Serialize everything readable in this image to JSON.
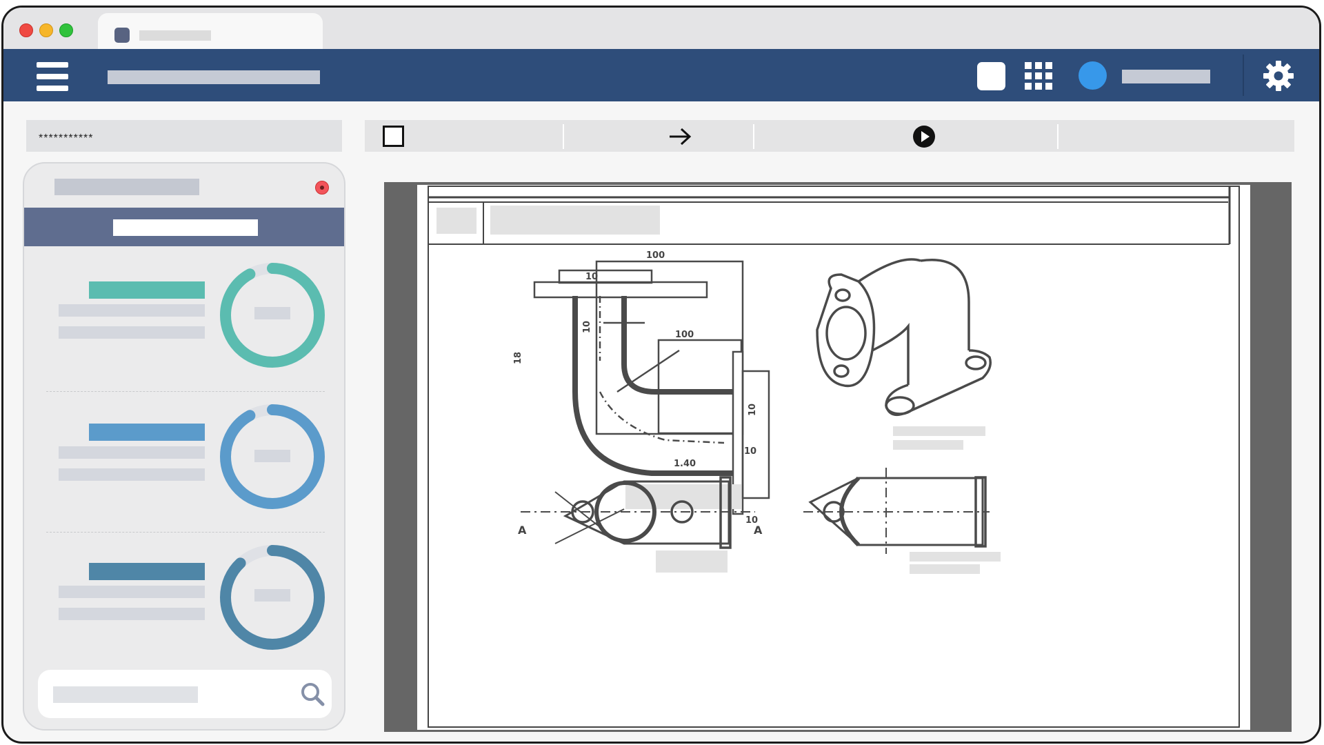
{
  "window": {
    "tab_icon": "document-icon"
  },
  "header": {
    "menu_icon": "hamburger-menu-icon",
    "apps_icon": "apps-grid-icon",
    "settings_icon": "gear-icon",
    "avatar_color": "#3798ea",
    "bar_color": "#2e4d7a"
  },
  "left_field": {
    "value": "***********"
  },
  "panel": {
    "metrics": [
      {
        "color": "#5bbcb0",
        "progress": 0.92
      },
      {
        "color": "#5b9bcb",
        "progress": 0.92
      },
      {
        "color": "#4f86a7",
        "progress": 0.88
      }
    ],
    "search_icon": "search-icon"
  },
  "toolbar": {
    "checkbox_icon": "checkbox-icon",
    "arrow_icon": "arrow-right-icon",
    "play_icon": "play-circle-icon"
  },
  "drawing": {
    "dim_labels": [
      "100",
      "10",
      "10",
      "18",
      "100",
      "10",
      "1.40",
      "10",
      "10",
      "A",
      "A"
    ]
  }
}
